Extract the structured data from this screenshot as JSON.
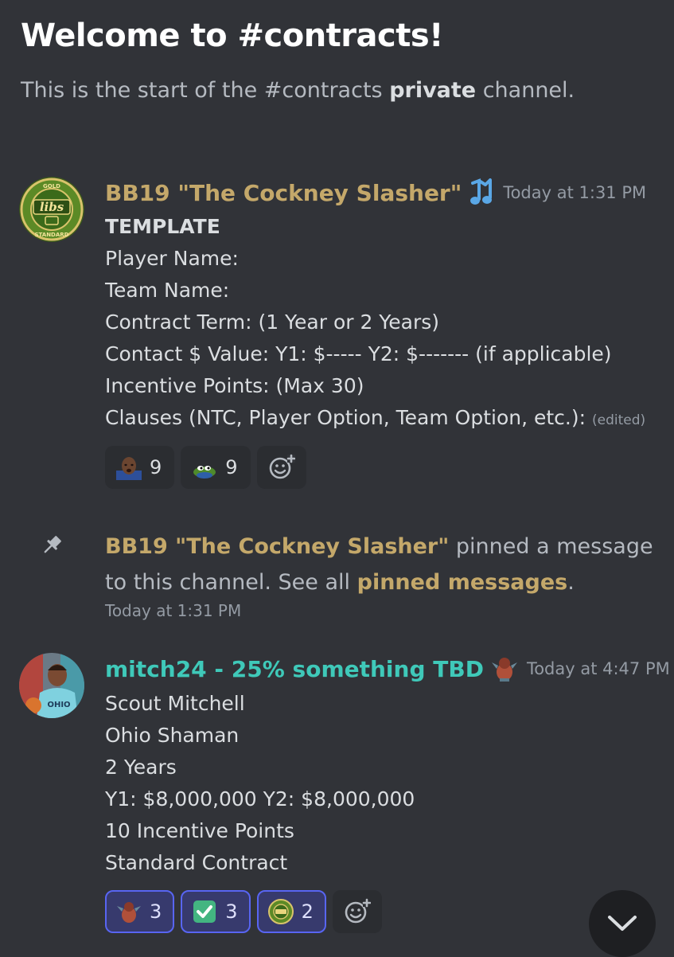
{
  "channel": {
    "welcome_title": "Welcome to #contracts!",
    "intro_prefix": "This is the start of the #contracts ",
    "intro_bold": "private",
    "intro_suffix": " channel."
  },
  "colors": {
    "background": "#313338",
    "bb19_name": "#c4a86a",
    "mitch_name": "#3fc9b9",
    "reaction_me_border": "#5865f2"
  },
  "messages": [
    {
      "author": "BB19 \"The Cockney Slasher\"",
      "badge_icon": "music-note-icon",
      "avatar_icon": "gold-standard-libs-badge",
      "avatar_text": "libs",
      "avatar_ring_text": "GOLD STANDARD",
      "timestamp": "Today at 1:31 PM",
      "lines": [
        "TEMPLATE",
        "Player Name:",
        "Team Name:",
        "Contract Term: (1 Year or 2 Years)",
        "Contact $ Value: Y1: $-----  Y2: $------- (if applicable)",
        "Incentive Points: (Max 30)",
        "Clauses (NTC, Player Option, Team Option, etc.):"
      ],
      "edited": "(edited)",
      "reactions": [
        {
          "icon": "bald-man-emoji",
          "count": "9"
        },
        {
          "icon": "pepe-frog-emoji",
          "count": "9"
        }
      ],
      "add_reaction_icon": "add-reaction-icon"
    },
    {
      "author": "mitch24 - 25% something TBD",
      "badge_icon": "dragon-figure-icon",
      "avatar_icon": "basketball-player-avatar",
      "avatar_jersey_text": "OHIO",
      "timestamp": "Today at 4:47 PM",
      "lines": [
        "Scout Mitchell",
        "Ohio Shaman",
        "2 Years",
        "Y1: $8,000,000 Y2: $8,000,000",
        "10 Incentive Points",
        "Standard Contract"
      ],
      "reactions": [
        {
          "icon": "dragon-figure-emoji",
          "count": "3"
        },
        {
          "icon": "check-mark-emoji",
          "count": "3"
        },
        {
          "icon": "gold-standard-emoji",
          "count": "2"
        }
      ],
      "add_reaction_icon": "add-reaction-icon"
    }
  ],
  "system_message": {
    "icon": "pin-icon",
    "author": "BB19 \"The Cockney Slasher\"",
    "text_mid": " pinned a message to this channel. See all ",
    "link": "pinned messages",
    "text_end": ".",
    "timestamp": "Today at 1:31 PM"
  },
  "jump_button_icon": "chevron-down-icon"
}
